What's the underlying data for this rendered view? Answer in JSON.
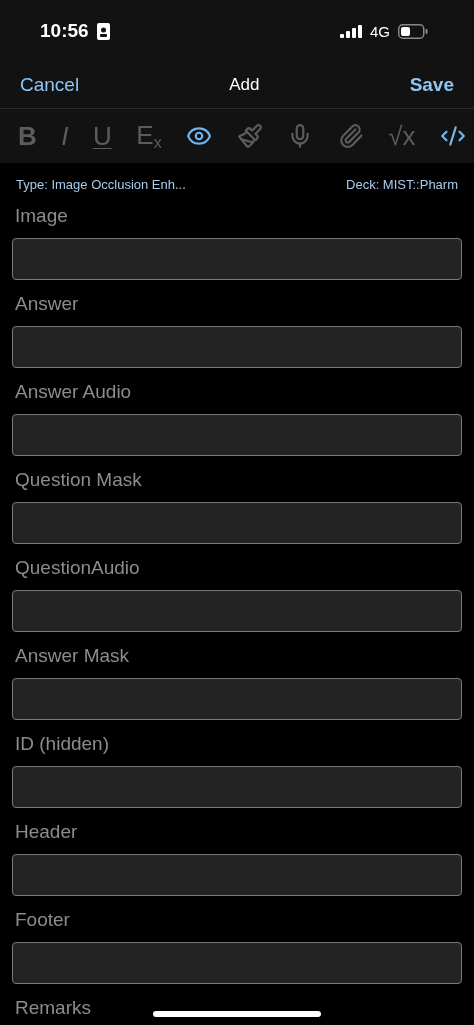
{
  "status_bar": {
    "time": "10:56",
    "network": "4G"
  },
  "nav": {
    "cancel": "Cancel",
    "title": "Add",
    "save": "Save"
  },
  "toolbar": [
    {
      "kind": "bold",
      "label": "B",
      "active": false
    },
    {
      "kind": "italic",
      "label": "I",
      "active": false
    },
    {
      "kind": "underline",
      "label": "U",
      "active": false
    },
    {
      "kind": "text",
      "label": "E$_{x}$",
      "active": false
    },
    {
      "kind": "eye",
      "active": true
    },
    {
      "kind": "brush",
      "active": false
    },
    {
      "kind": "mic",
      "active": false
    },
    {
      "kind": "clip",
      "active": false
    },
    {
      "kind": "text",
      "label": "√x",
      "active": false
    },
    {
      "kind": "code",
      "active": true
    }
  ],
  "info": {
    "type": "Type: Image Occlusion Enh...",
    "deck": "Deck: MIST::Pharm"
  },
  "fields": [
    {
      "label": "Image"
    },
    {
      "label": "Answer"
    },
    {
      "label": "Answer Audio"
    },
    {
      "label": "Question Mask"
    },
    {
      "label": "QuestionAudio"
    },
    {
      "label": "Answer Mask"
    },
    {
      "label": "ID (hidden)"
    },
    {
      "label": "Header"
    },
    {
      "label": "Footer"
    },
    {
      "label": "Remarks"
    }
  ]
}
